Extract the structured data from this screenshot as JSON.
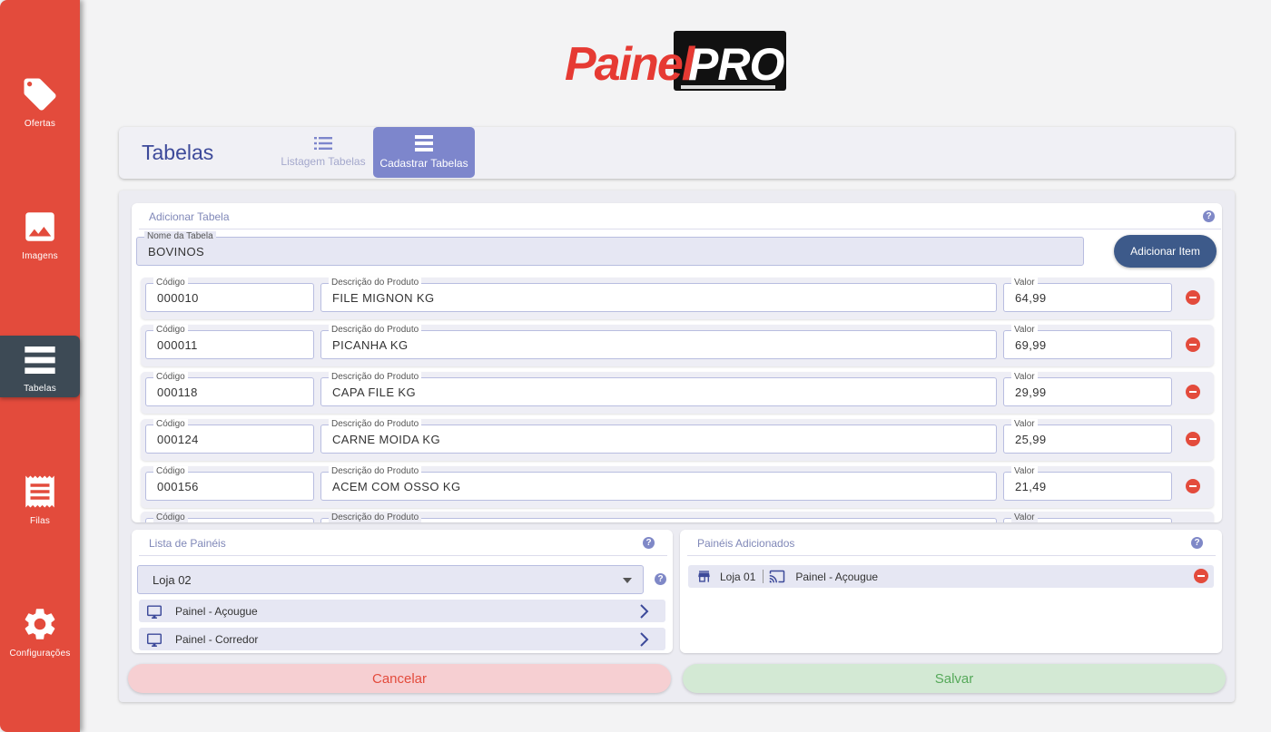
{
  "sidebar": {
    "items": [
      {
        "label": "Ofertas",
        "icon": "tag-icon"
      },
      {
        "label": "Imagens",
        "icon": "image-icon"
      },
      {
        "label": "Tabelas",
        "icon": "table-icon"
      },
      {
        "label": "Filas",
        "icon": "receipt-icon"
      },
      {
        "label": "Configurações",
        "icon": "gear-icon"
      }
    ],
    "active": "Tabelas"
  },
  "logo": {
    "part1": "Painel",
    "part2": "PRO"
  },
  "header": {
    "title": "Tabelas",
    "tabs": [
      {
        "label": "Listagem Tabelas",
        "icon": "list-icon",
        "active": false
      },
      {
        "label": "Cadastrar Tabelas",
        "icon": "table-icon",
        "active": true
      }
    ]
  },
  "add_table": {
    "title": "Adicionar Tabela",
    "help": "?",
    "name_label": "Nome da Tabela",
    "name_value": "BOVINOS",
    "add_item_button": "Adicionar Item",
    "col_code": "Código",
    "col_desc": "Descrição do Produto",
    "col_value": "Valor",
    "items": [
      {
        "code": "000010",
        "desc": "FILE MIGNON KG",
        "value": "64,99"
      },
      {
        "code": "000011",
        "desc": "PICANHA KG",
        "value": "69,99"
      },
      {
        "code": "000118",
        "desc": "CAPA FILE KG",
        "value": "29,99"
      },
      {
        "code": "000124",
        "desc": "CARNE MOIDA KG",
        "value": "25,99"
      },
      {
        "code": "000156",
        "desc": "ACEM COM OSSO KG",
        "value": "21,49"
      }
    ]
  },
  "panel_list": {
    "title": "Lista de Painéis",
    "help": "?",
    "store_select": "Loja 02",
    "panels": [
      {
        "label": "Painel - Açougue"
      },
      {
        "label": "Painel - Corredor"
      }
    ]
  },
  "added_panels": {
    "title": "Painéis Adicionados",
    "help": "?",
    "items": [
      {
        "store": "Loja 01",
        "panel": "Painel - Açougue"
      }
    ]
  },
  "actions": {
    "cancel": "Cancelar",
    "save": "Salvar"
  },
  "colors": {
    "sidebar": "#e34b3c",
    "sidebar_active": "#3d4a55",
    "accent": "#7d86cc",
    "title": "#3d4a9a",
    "cancel_bg": "#f6cfd2",
    "cancel_text": "#e34b3c",
    "save_bg": "#d3e9d4",
    "save_text": "#56a95a"
  }
}
